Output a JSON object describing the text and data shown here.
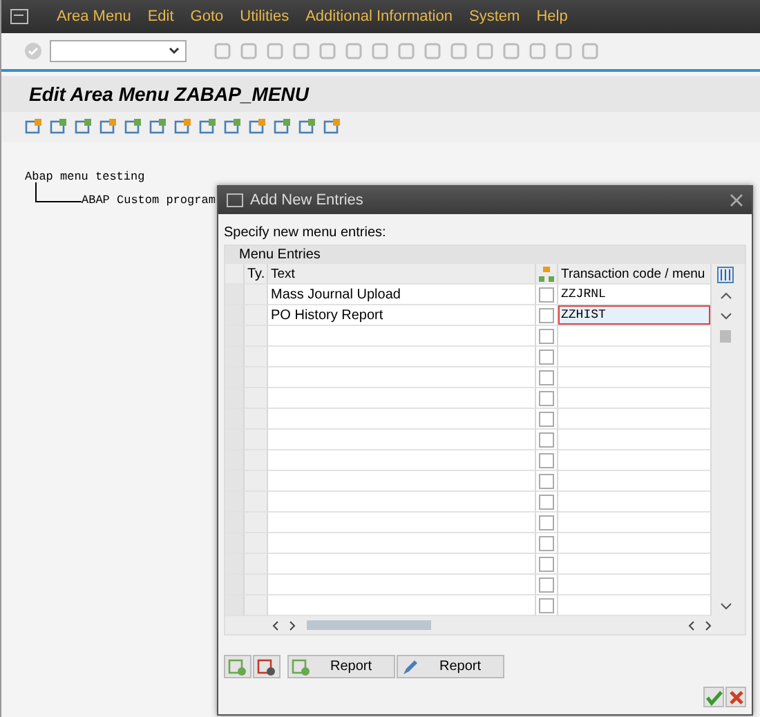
{
  "menu_bar": {
    "items": [
      "Area Menu",
      "Edit",
      "Goto",
      "Utilities",
      "Additional Information",
      "System",
      "Help"
    ]
  },
  "screen_title": "Edit Area Menu ZABAP_MENU",
  "tree": {
    "label": "Abap menu testing",
    "children": [
      {
        "label": "ABAP Custom program"
      }
    ]
  },
  "dialog": {
    "title": "Add New Entries",
    "instruction": "Specify new menu entries:",
    "group_title": "Menu Entries",
    "columns": [
      "Ty.",
      "Text",
      "Transaction code / menu"
    ],
    "rows": [
      {
        "text": "Mass Journal Upload",
        "checked": false,
        "code": "ZZJRNL",
        "focused": false
      },
      {
        "text": "PO History Report",
        "checked": false,
        "code": "ZZHIST",
        "focused": true
      },
      {
        "checked": false
      },
      {
        "checked": false
      },
      {
        "checked": false
      },
      {
        "checked": false
      },
      {
        "checked": false
      },
      {
        "checked": false
      },
      {
        "checked": false
      },
      {
        "checked": false
      },
      {
        "checked": false
      },
      {
        "checked": false
      },
      {
        "checked": false
      },
      {
        "checked": false
      },
      {
        "checked": false
      },
      {
        "checked": false
      }
    ],
    "buttons": [
      "Report",
      "Report"
    ]
  }
}
